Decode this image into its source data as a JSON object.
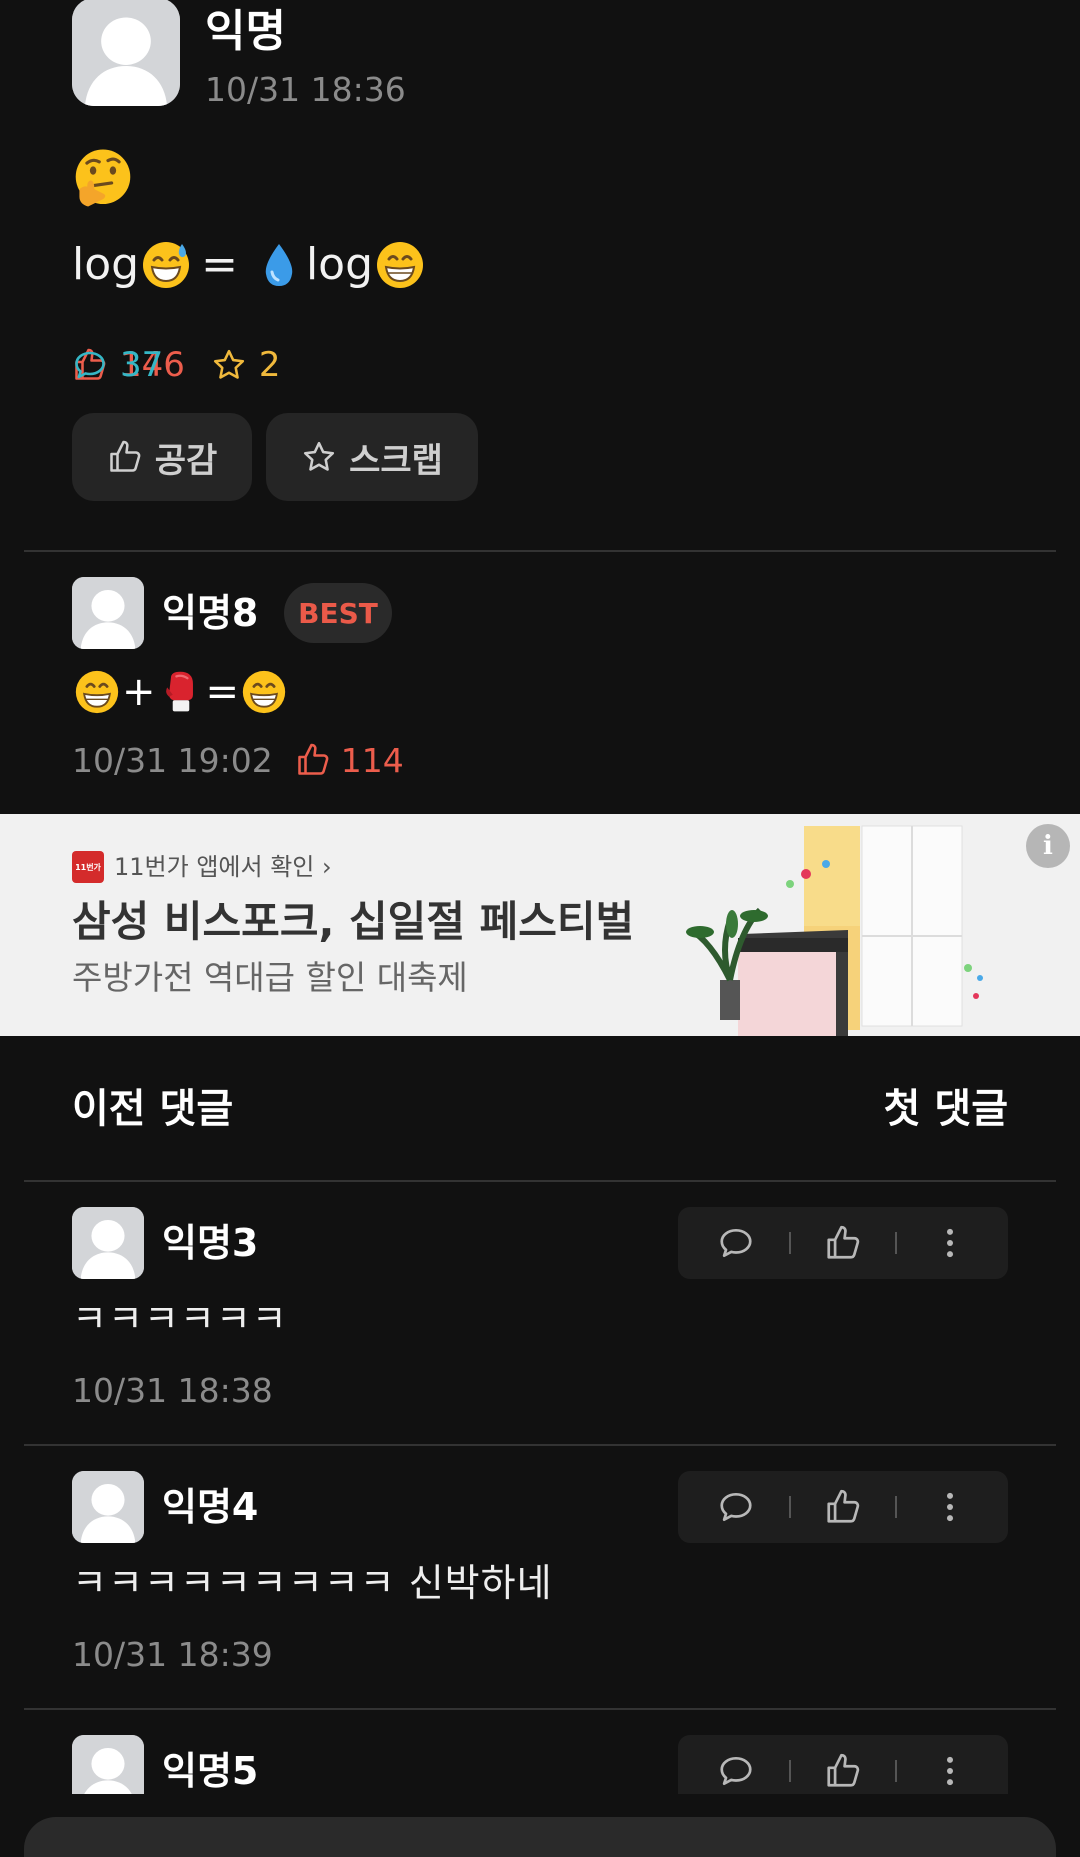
{
  "post": {
    "author": "익명",
    "time": "10/31 18:36",
    "body_part1": "log",
    "body_equals": "=",
    "body_part2": "log",
    "like_count": "146",
    "comment_count": "37",
    "scrap_count": "2",
    "like_button": "공감",
    "scrap_button": "스크랩"
  },
  "best_comment": {
    "author": "익명8",
    "badge": "BEST",
    "body_plus": "+",
    "body_equals": "=",
    "time": "10/31 19:02",
    "like_count": "114"
  },
  "ad": {
    "logo_text": "11번가",
    "source": "11번가 앱에서 확인 ›",
    "title": "삼성 비스포크, 십일절 페스티벌",
    "subtitle": "주방가전 역대급 할인 대축제",
    "info_icon": "i"
  },
  "nav": {
    "prev": "이전 댓글",
    "first": "첫 댓글"
  },
  "comments": [
    {
      "author": "익명3",
      "body": "ㅋㅋㅋㅋㅋㅋ",
      "time": "10/31 18:38"
    },
    {
      "author": "익명4",
      "body": "ㅋㅋㅋㅋㅋㅋㅋㅋㅋ 신박하네",
      "time": "10/31 18:39"
    },
    {
      "author": "익명5"
    }
  ],
  "colors": {
    "background": "#111111",
    "like": "#ec5d4c",
    "comment": "#35b7c6",
    "scrap": "#f0b93c",
    "muted": "#8b8b8b"
  },
  "icons": [
    "thumbs-up-icon",
    "speech-bubble-icon",
    "star-icon",
    "more-vertical-icon",
    "info-icon"
  ]
}
